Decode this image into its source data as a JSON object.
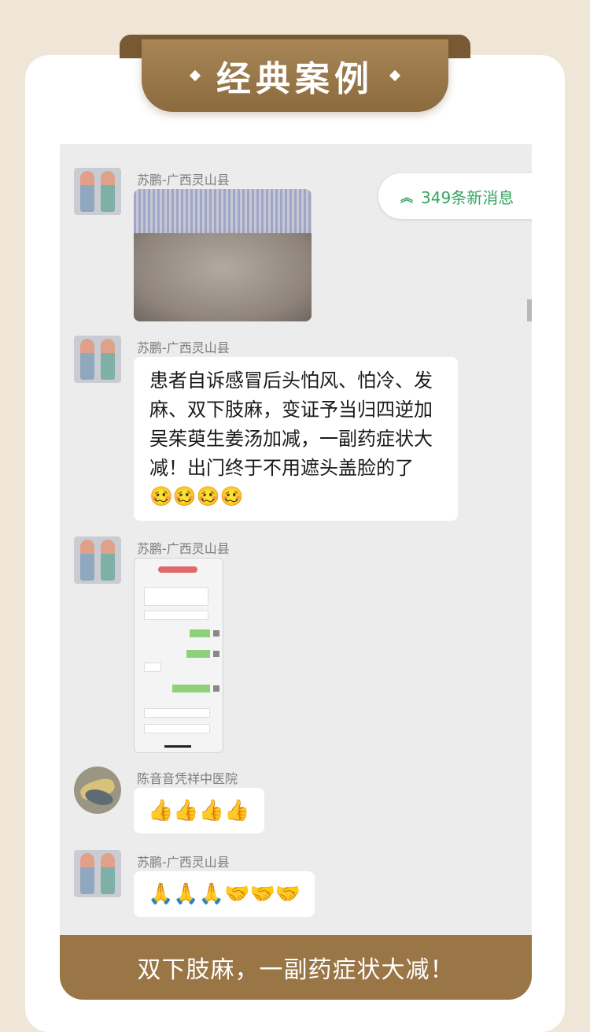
{
  "banner": {
    "title": "经典案例"
  },
  "new_messages": {
    "label": "349条新消息"
  },
  "messages": [
    {
      "sender": "苏鹏-广西灵山县",
      "type": "image"
    },
    {
      "sender": "苏鹏-广西灵山县",
      "type": "text",
      "text": "患者自诉感冒后头怕风、怕冷、发麻、双下肢麻，变证予当归四逆加吴茱萸生姜汤加减，一副药症状大减！出门终于不用遮头盖脸的了",
      "emojis": "🥴🥴🥴🥴"
    },
    {
      "sender": "苏鹏-广西灵山县",
      "type": "screenshot"
    },
    {
      "sender": "陈音音凭祥中医院",
      "type": "emoji",
      "emojis": "👍👍👍👍"
    },
    {
      "sender": "苏鹏-广西灵山县",
      "type": "emoji",
      "emojis": "🙏🙏🙏🤝🤝🤝"
    }
  ],
  "footer": {
    "caption": "双下肢麻，一副药症状大减！"
  },
  "colors": {
    "accent_gold": "#9a7545",
    "new_message_green": "#35a55f"
  }
}
